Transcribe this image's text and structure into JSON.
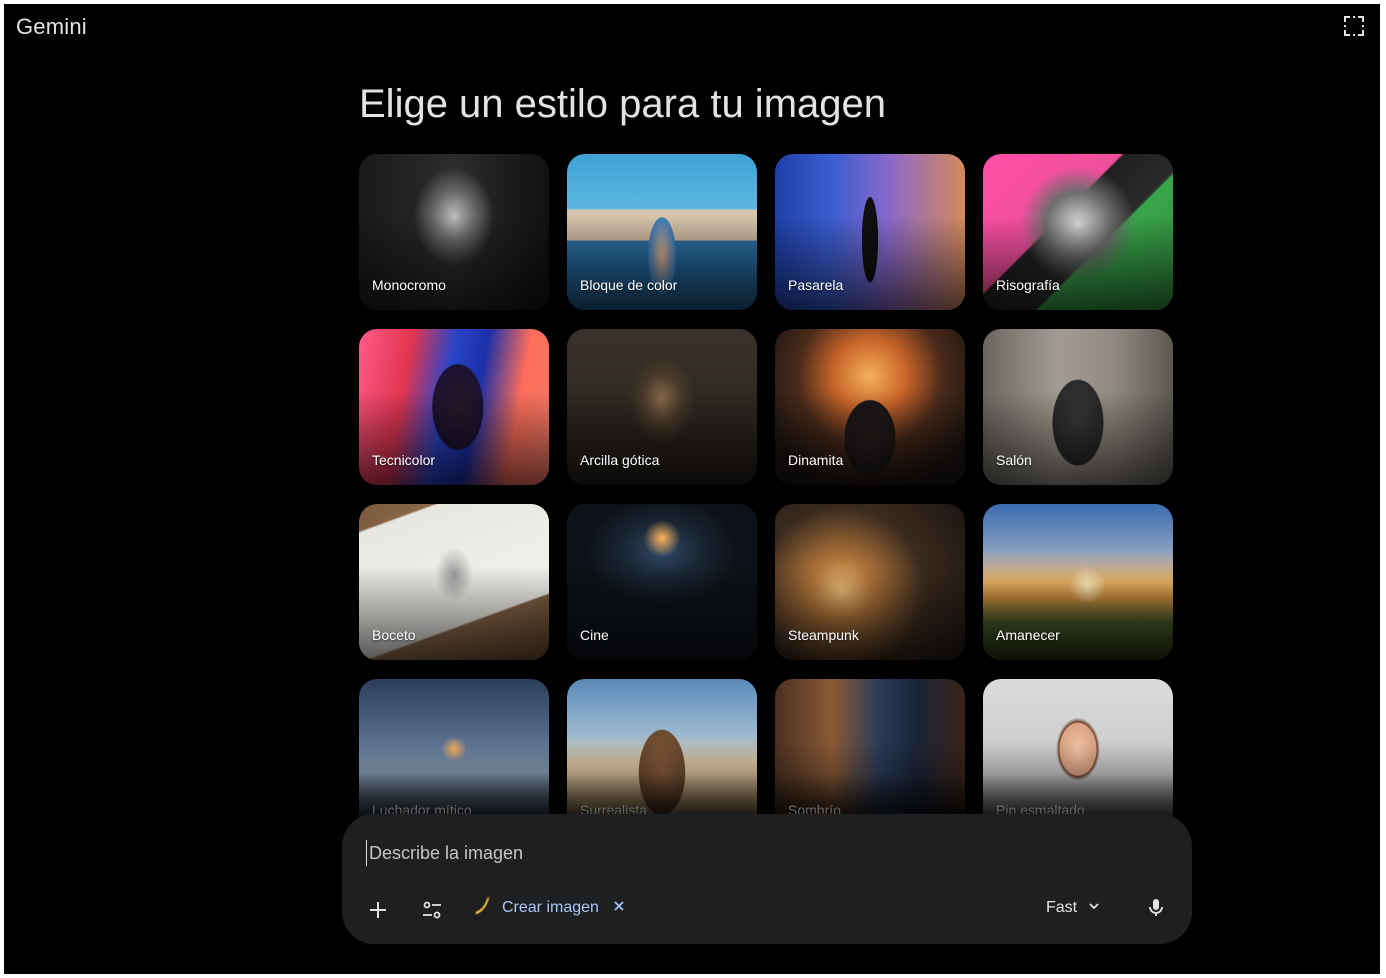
{
  "header": {
    "app_title": "Gemini",
    "corner_icon": "selection-frame-icon"
  },
  "main": {
    "heading": "Elige un estilo para tu imagen",
    "styles": [
      {
        "label": "Monocromo"
      },
      {
        "label": "Bloque de color"
      },
      {
        "label": "Pasarela"
      },
      {
        "label": "Risografía"
      },
      {
        "label": "Tecnicolor"
      },
      {
        "label": "Arcilla gótica"
      },
      {
        "label": "Dinamita"
      },
      {
        "label": "Salón"
      },
      {
        "label": "Boceto"
      },
      {
        "label": "Cine"
      },
      {
        "label": "Steampunk"
      },
      {
        "label": "Amanecer"
      },
      {
        "label": "Luchador mítico"
      },
      {
        "label": "Surrealista"
      },
      {
        "label": "Sombrío"
      },
      {
        "label": "Pin esmaltado"
      }
    ]
  },
  "composer": {
    "placeholder": "Describe la imagen",
    "value": "",
    "add_icon": "plus-icon",
    "tools_icon": "tools-icon",
    "chip_label": "Crear imagen",
    "chip_icon": "banana-icon",
    "chip_close_icon": "close-icon",
    "model_label": "Fast",
    "model_icon": "chevron-down-icon",
    "mic_icon": "microphone-icon"
  },
  "colors": {
    "background": "#000000",
    "composer": "#1e1f20",
    "accent": "#a8c7fa",
    "text": "#e3e3e3"
  }
}
